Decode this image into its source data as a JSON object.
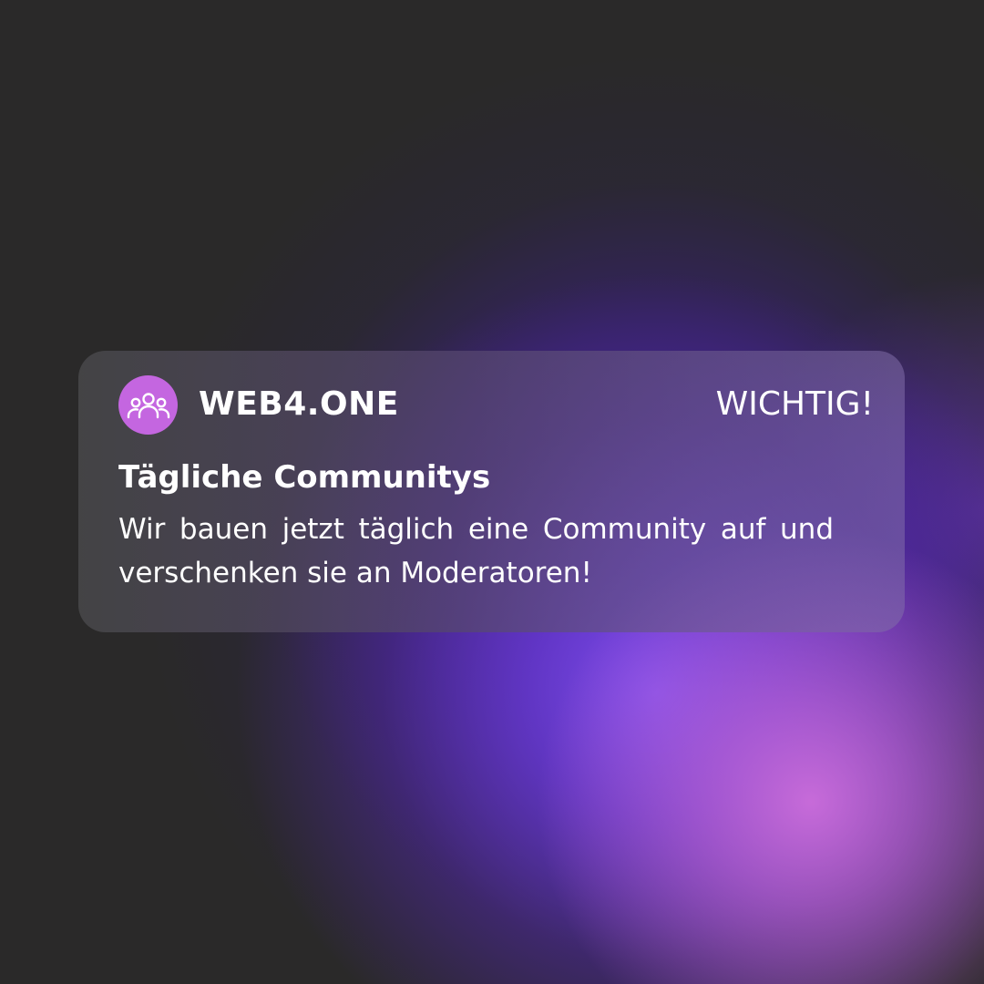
{
  "notification": {
    "app_icon": "community-group-icon",
    "app_name": "WEB4.ONE",
    "priority_label": "WICHTIG!",
    "title": "Tägliche Communitys",
    "message": "Wir bauen jetzt täglich eine Community auf und verschenken sie an Moderatoren!"
  },
  "colors": {
    "background": "#2a2929",
    "icon_circle": "#c466e0",
    "text": "#ffffff"
  }
}
